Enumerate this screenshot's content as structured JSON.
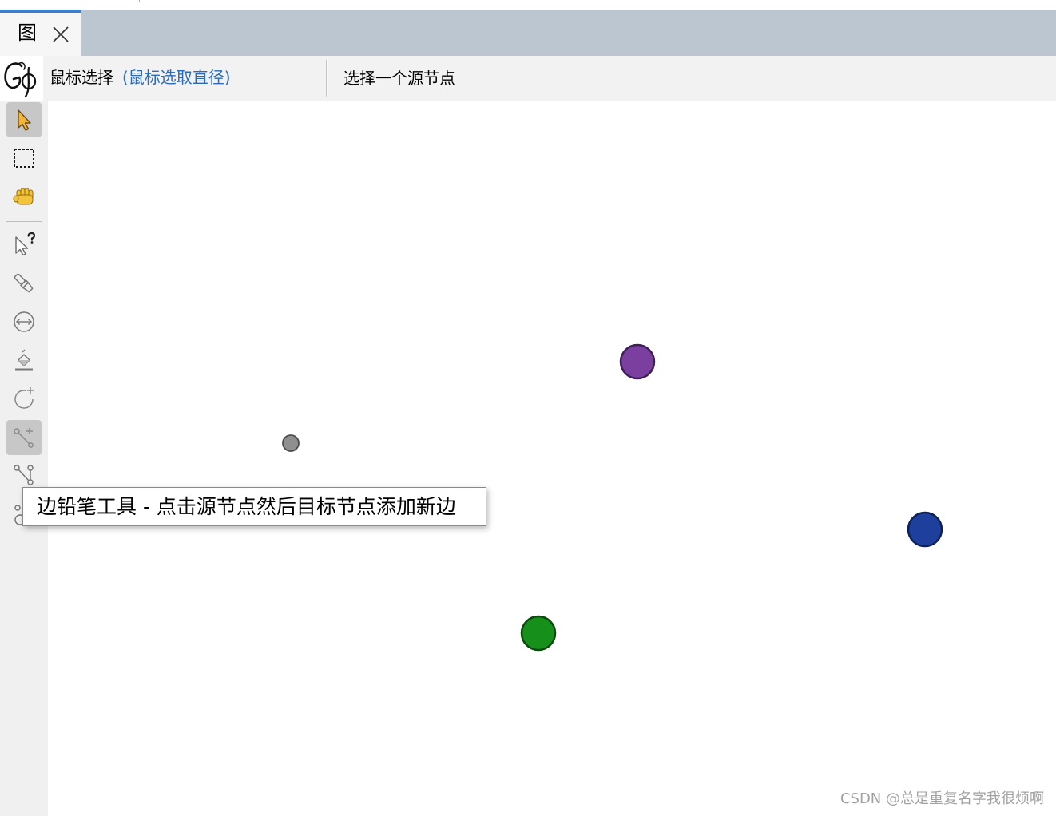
{
  "tab": {
    "title": "图",
    "close_icon": "close-icon",
    "accent_color": "#3a7fc7"
  },
  "logo": {
    "icon": "gephi-logo-icon"
  },
  "toolbar": {
    "mode_label": "鼠标选择",
    "mode_detail": "(鼠标选取直径)",
    "detail_color": "#2b6cb8",
    "status": "选择一个源节点"
  },
  "tools": [
    {
      "icon": "select-arrow-icon",
      "selected": true
    },
    {
      "icon": "rectangle-select-icon",
      "selected": false
    },
    {
      "icon": "drag-hand-icon",
      "selected": false
    },
    {
      "icon": "pointer-help-icon",
      "selected": false
    },
    {
      "icon": "paint-brush-icon",
      "selected": false
    },
    {
      "icon": "resize-icon",
      "selected": false
    },
    {
      "icon": "bucket-icon",
      "selected": false
    },
    {
      "icon": "add-node-icon",
      "selected": false
    },
    {
      "icon": "edge-pencil-icon",
      "selected": true
    },
    {
      "icon": "shortest-path-icon",
      "selected": false
    },
    {
      "icon": "circles-icon",
      "selected": false
    }
  ],
  "tooltip": "边铅笔工具 - 点击源节点然后目标节点添加新边",
  "graph": {
    "nodes": [
      {
        "fill": "#7b3fa0",
        "stroke": "#3e1f56"
      },
      {
        "fill": "#8f8f8f",
        "stroke": "#4d4d4d"
      },
      {
        "fill": "#1e3f9c",
        "stroke": "#0d2259"
      },
      {
        "fill": "#17901b",
        "stroke": "#0a4a0d"
      }
    ]
  },
  "watermark": "CSDN @总是重复名字我很烦啊"
}
